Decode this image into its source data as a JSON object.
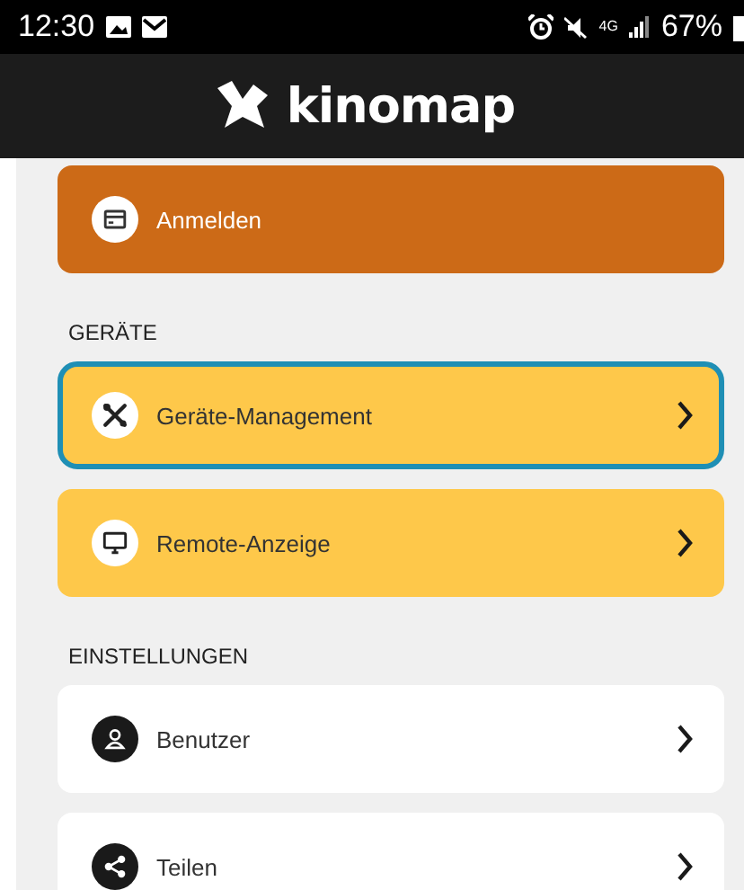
{
  "status_bar": {
    "time": "12:30",
    "network": "4G",
    "battery": "67%"
  },
  "header": {
    "logo_text": "kinomap"
  },
  "menu": [
    {
      "kind": "login",
      "label": "Anmelden",
      "chevron": false,
      "focused": false
    },
    {
      "kind": "heading",
      "label": "GERÄTE"
    },
    {
      "kind": "device",
      "label": "Geräte-Management",
      "chevron": true,
      "focused": true
    },
    {
      "kind": "device",
      "label": "Remote-Anzeige",
      "chevron": true,
      "focused": false
    },
    {
      "kind": "heading",
      "label": "EINSTELLUNGEN"
    },
    {
      "kind": "setting",
      "label": "Benutzer",
      "chevron": true,
      "focused": false
    },
    {
      "kind": "setting",
      "label": "Teilen",
      "chevron": true,
      "focused": false
    }
  ]
}
